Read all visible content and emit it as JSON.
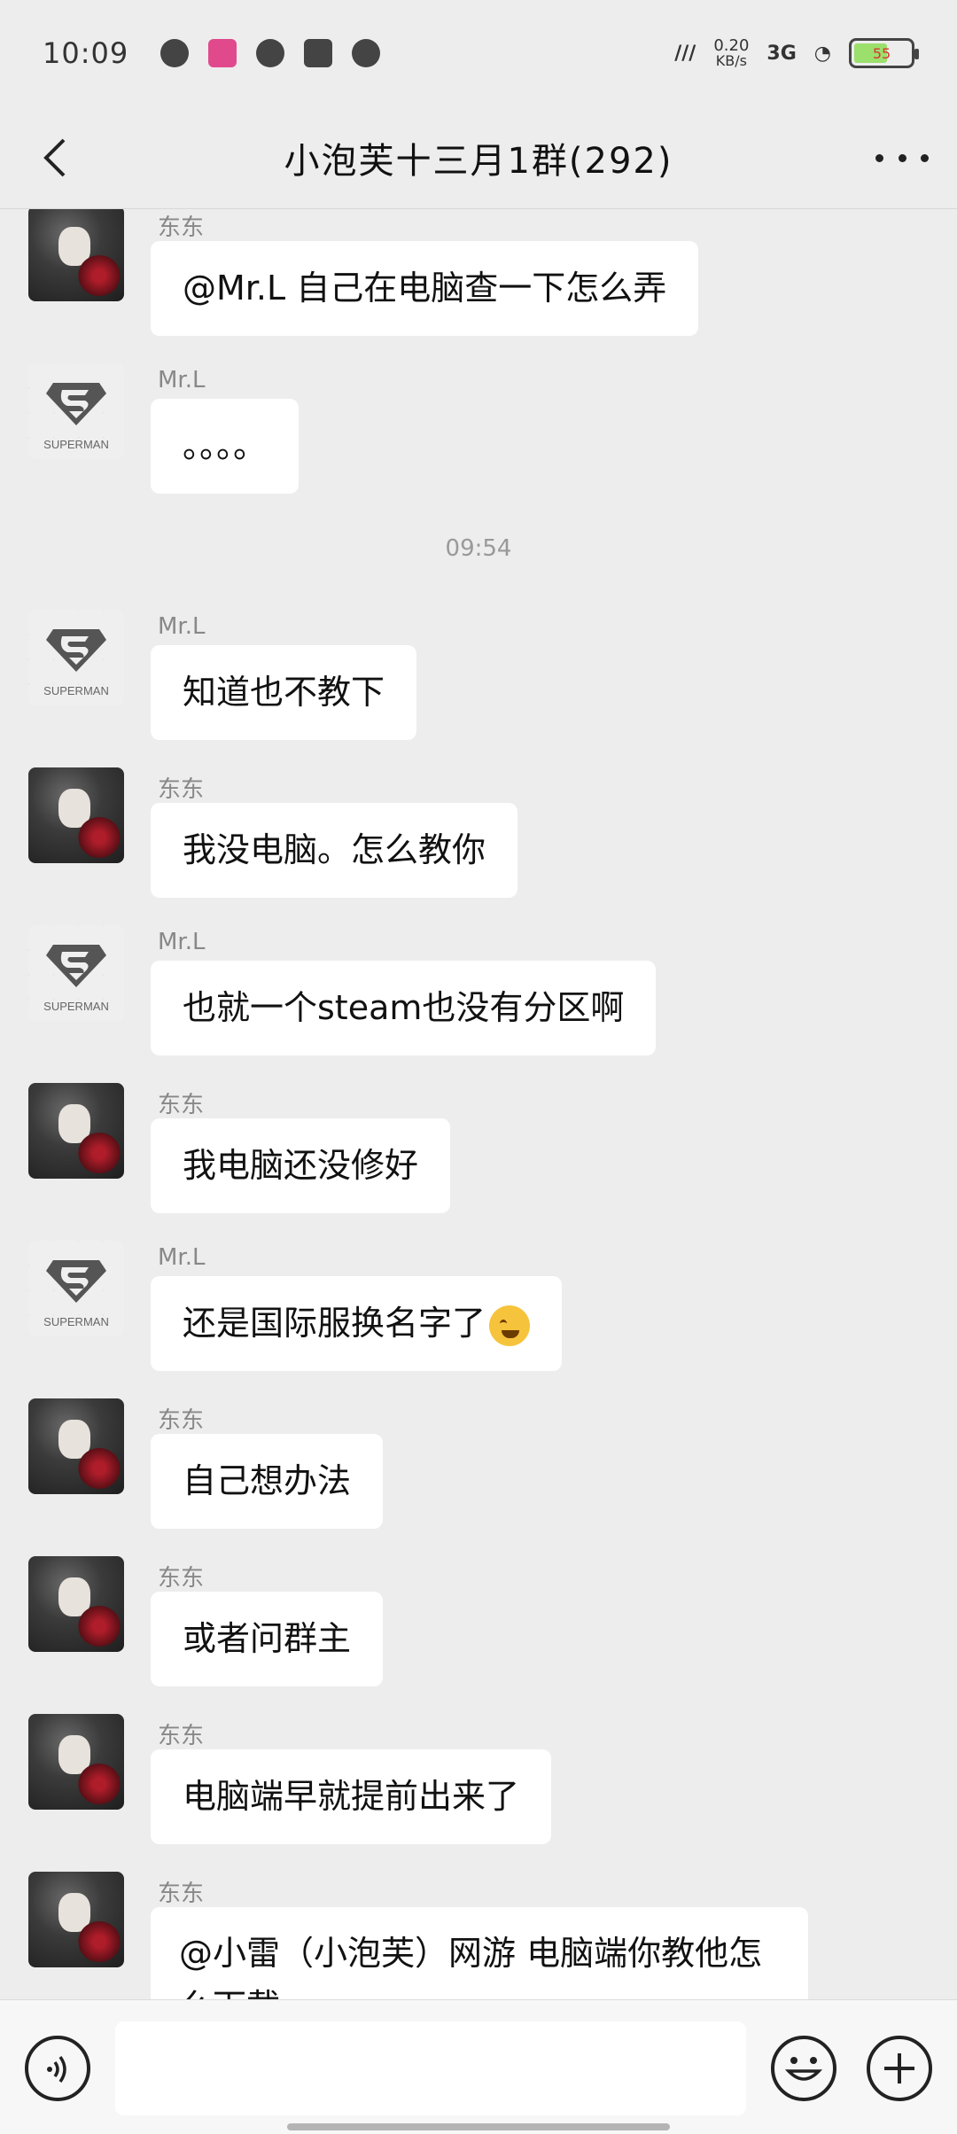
{
  "status_bar": {
    "time": "10:09",
    "net_speed": "0.20",
    "net_unit": "KB/s",
    "signal": "3G",
    "battery": "55"
  },
  "header": {
    "title": "小泡芙十三月1群(292)"
  },
  "timestamp": "09:54",
  "messages": [
    {
      "sender": "东东",
      "text": "@Mr.L 自己在电脑查一下怎么弄"
    },
    {
      "sender": "Mr.L",
      "text": "。。。。"
    },
    {
      "sender": "Mr.L",
      "text": "知道也不教下"
    },
    {
      "sender": "东东",
      "text": "我没电脑。怎么教你"
    },
    {
      "sender": "Mr.L",
      "text": "也就一个steam也没有分区啊"
    },
    {
      "sender": "东东",
      "text": "我电脑还没修好"
    },
    {
      "sender": "Mr.L",
      "text": "还是国际服换名字了"
    },
    {
      "sender": "东东",
      "text": "自己想办法"
    },
    {
      "sender": "东东",
      "text": "或者问群主"
    },
    {
      "sender": "东东",
      "text": "电脑端早就提前出来了"
    },
    {
      "sender": "东东",
      "text": "@小雷（小泡芙）网游 电脑端你教他怎么下载"
    }
  ],
  "avatars": {
    "mrl_logo_text": "SUPERMAN"
  },
  "icons": {
    "emoji_in_message": "laughing-crying-emoji",
    "voice": "voice-icon",
    "emoji_btn": "smiley-icon",
    "plus": "plus-icon"
  }
}
